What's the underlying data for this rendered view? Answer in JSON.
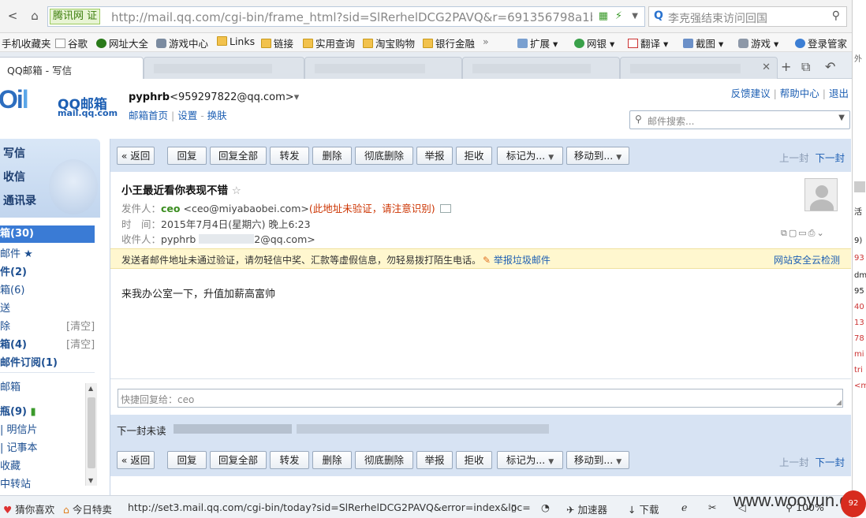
{
  "browser": {
    "site_badge": "腾讯网 证",
    "url": "http://mail.qq.com/cgi-bin/frame_html?sid=SlRerhelDCG2PAVQ&r=691356798a1b",
    "search_placeholder": "李克强结束访问回国",
    "favorites": [
      {
        "label": "手机收藏夹"
      },
      {
        "label": "谷歌"
      },
      {
        "label": "网址大全"
      },
      {
        "label": "游戏中心"
      },
      {
        "label": "Links"
      },
      {
        "label": "链接"
      },
      {
        "label": "实用查询"
      },
      {
        "label": "淘宝购物"
      },
      {
        "label": "银行金融"
      },
      {
        "label": "»"
      },
      {
        "label": "扩展"
      },
      {
        "label": "网银"
      },
      {
        "label": "翻译"
      },
      {
        "label": "截图"
      },
      {
        "label": "游戏"
      },
      {
        "label": "登录管家"
      }
    ],
    "active_tab": "QQ邮箱 - 写信"
  },
  "header": {
    "logo_name": "QQ邮箱",
    "logo_url": "mail.qq.com",
    "username": "pyphrb",
    "email": "<959297822@qq.com>",
    "links": [
      "邮箱首页",
      "设置",
      "换肤"
    ],
    "top_links": [
      "反馈建议",
      "帮助中心",
      "退出"
    ],
    "search_placeholder": "邮件搜索..."
  },
  "sidebar": {
    "actions": [
      "写信",
      "收信",
      "通讯录"
    ],
    "folders": [
      {
        "label": "箱(30)",
        "bold": true,
        "selected": true
      },
      {
        "label": "邮件 ★"
      },
      {
        "label": "件(2)",
        "bold": true
      },
      {
        "label": "箱(6)"
      },
      {
        "label": "送"
      },
      {
        "label": "除",
        "clear": "[清空]"
      },
      {
        "label": "箱(4)",
        "bold": true,
        "clear": "[清空]"
      },
      {
        "label": "邮件订阅(1)",
        "bold": true
      },
      {
        "label": "邮箱"
      },
      {
        "label": "瓶(9)",
        "bold": true
      },
      {
        "label": "| 明信片"
      },
      {
        "label": "| 记事本"
      },
      {
        "label": "收藏"
      },
      {
        "label": "中转站"
      }
    ]
  },
  "toolbar": {
    "buttons": [
      "« 返回",
      "回复",
      "回复全部",
      "转发",
      "删除",
      "彻底删除",
      "举报",
      "拒收",
      "标记为...",
      "移动到..."
    ],
    "prev": "上一封",
    "next": "下一封"
  },
  "message": {
    "subject": "小王最近看你表现不错",
    "from_label": "发件人：",
    "from_name": "ceo",
    "from_addr": "<ceo@miyabaobei.com>",
    "from_warning": "(此地址未验证，请注意识别)",
    "time_label": "时　间：",
    "time": "2015年7月4日(星期六) 晚上6:23",
    "to_label": "收件人：",
    "to_name": "pyphrb",
    "to_addr": "2@qq.com>",
    "warning": "发送者邮件地址未通过验证，请勿轻信中奖、汇款等虚假信息，勿轻易拨打陌生电话。",
    "report_spam": "举报垃圾邮件",
    "security_check": "网站安全云检测",
    "body": "来我办公室一下，升值加薪高富帅",
    "quick_reply_placeholder": "快捷回复给：ceo",
    "next_unread_label": "下一封未读"
  },
  "status": {
    "left": [
      "猜你喜欢",
      "今日特卖"
    ],
    "url": "http://set3.mail.qq.com/cgi-bin/today?sid=SlRerhelDCG2PAVQ&error=index&loc=",
    "right": [
      "加速器",
      "下载",
      "100%"
    ],
    "watermark": "www.wooyun.org"
  }
}
